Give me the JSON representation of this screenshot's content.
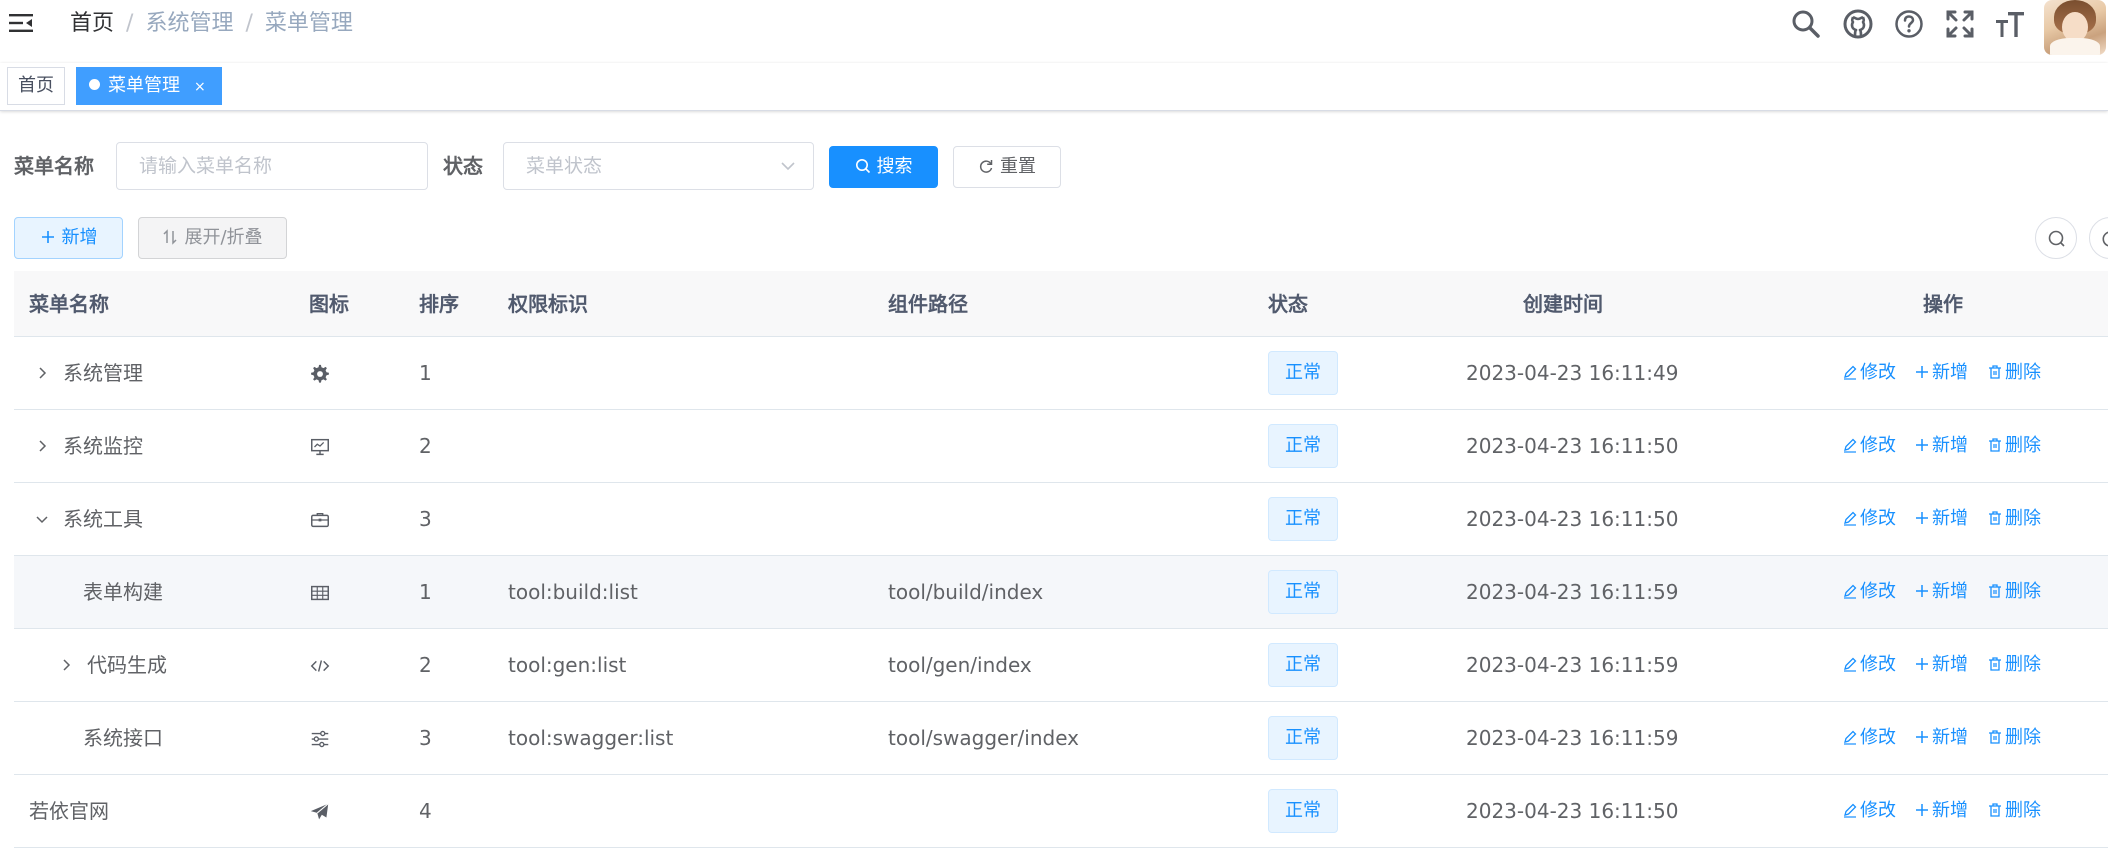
{
  "breadcrumb": {
    "home": "首页",
    "items": [
      "系统管理",
      "菜单管理"
    ],
    "separator": "/"
  },
  "right_menu": [
    "search-icon",
    "github-icon",
    "question-icon",
    "fullscreen-icon",
    "font-size-icon"
  ],
  "tags": [
    {
      "label": "首页",
      "active": false
    },
    {
      "label": "菜单管理",
      "active": true,
      "close": "×"
    }
  ],
  "search": {
    "menu_name_label": "菜单名称",
    "menu_name_placeholder": "请输入菜单名称",
    "status_label": "状态",
    "status_placeholder": "菜单状态",
    "search_button": "搜索",
    "reset_button": "重置"
  },
  "toolbar": {
    "add_button": "新增",
    "expand_button": "展开/折叠"
  },
  "table": {
    "headers": [
      "菜单名称",
      "图标",
      "排序",
      "权限标识",
      "组件路径",
      "状态",
      "创建时间",
      "操作"
    ],
    "rows": [
      {
        "name": "系统管理",
        "icon": "gear-icon",
        "order": "1",
        "perms": "",
        "component": "",
        "status": "正常",
        "created": "2023-04-23 16:11:49",
        "level": 0,
        "expander": "collapsed"
      },
      {
        "name": "系统监控",
        "icon": "monitor-icon",
        "order": "2",
        "perms": "",
        "component": "",
        "status": "正常",
        "created": "2023-04-23 16:11:50",
        "level": 0,
        "expander": "collapsed"
      },
      {
        "name": "系统工具",
        "icon": "toolbox-icon",
        "order": "3",
        "perms": "",
        "component": "",
        "status": "正常",
        "created": "2023-04-23 16:11:50",
        "level": 0,
        "expander": "expanded"
      },
      {
        "name": "表单构建",
        "icon": "table-icon",
        "order": "1",
        "perms": "tool:build:list",
        "component": "tool/build/index",
        "status": "正常",
        "created": "2023-04-23 16:11:59",
        "level": 1,
        "expander": "none"
      },
      {
        "name": "代码生成",
        "icon": "code-icon",
        "order": "2",
        "perms": "tool:gen:list",
        "component": "tool/gen/index",
        "status": "正常",
        "created": "2023-04-23 16:11:59",
        "level": 1,
        "expander": "collapsed"
      },
      {
        "name": "系统接口",
        "icon": "sliders-icon",
        "order": "3",
        "perms": "tool:swagger:list",
        "component": "tool/swagger/index",
        "status": "正常",
        "created": "2023-04-23 16:11:59",
        "level": 1,
        "expander": "none"
      },
      {
        "name": "若依官网",
        "icon": "send-icon",
        "order": "4",
        "perms": "",
        "component": "",
        "status": "正常",
        "created": "2023-04-23 16:11:50",
        "level": 0,
        "expander": "none"
      }
    ],
    "actions": {
      "edit": "修改",
      "add": "新增",
      "delete": "删除"
    }
  }
}
